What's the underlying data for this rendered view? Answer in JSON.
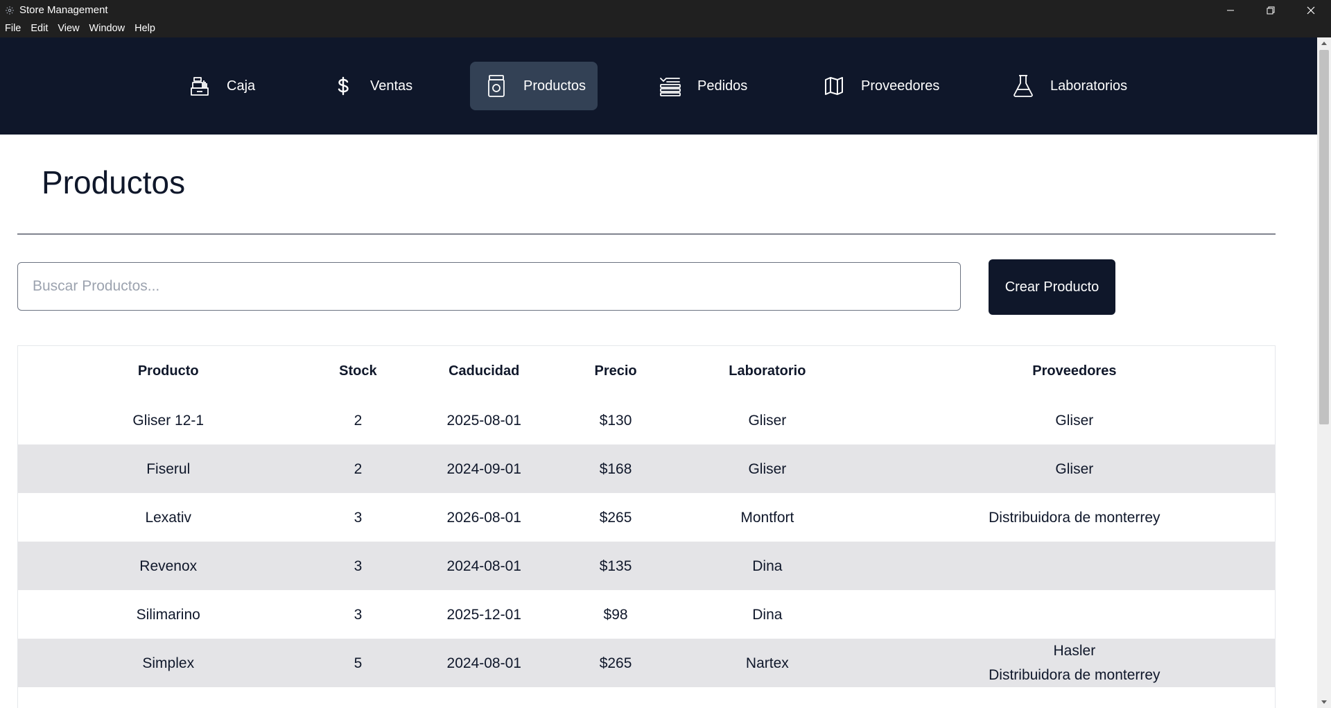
{
  "window": {
    "title": "Store Management"
  },
  "menu": [
    "File",
    "Edit",
    "View",
    "Window",
    "Help"
  ],
  "nav": {
    "items": [
      {
        "label": "Caja",
        "icon": "cash-register-icon"
      },
      {
        "label": "Ventas",
        "icon": "dollar-icon"
      },
      {
        "label": "Productos",
        "icon": "pill-bottle-icon",
        "active": true
      },
      {
        "label": "Pedidos",
        "icon": "stacked-list-icon"
      },
      {
        "label": "Proveedores",
        "icon": "map-icon"
      },
      {
        "label": "Laboratorios",
        "icon": "flask-icon"
      }
    ]
  },
  "page": {
    "title": "Productos"
  },
  "search": {
    "placeholder": "Buscar Productos...",
    "value": ""
  },
  "create_button": {
    "label": "Crear Producto"
  },
  "table": {
    "headers": [
      "Producto",
      "Stock",
      "Caducidad",
      "Precio",
      "Laboratorio",
      "Proveedores"
    ],
    "rows": [
      {
        "producto": "Gliser 12-1",
        "stock": "2",
        "caducidad": "2025-08-01",
        "precio": "$130",
        "laboratorio": "Gliser",
        "proveedores": [
          "Gliser"
        ]
      },
      {
        "producto": "Fiserul",
        "stock": "2",
        "caducidad": "2024-09-01",
        "precio": "$168",
        "laboratorio": "Gliser",
        "proveedores": [
          "Gliser"
        ]
      },
      {
        "producto": "Lexativ",
        "stock": "3",
        "caducidad": "2026-08-01",
        "precio": "$265",
        "laboratorio": "Montfort",
        "proveedores": [
          "Distribuidora de monterrey"
        ]
      },
      {
        "producto": "Revenox",
        "stock": "3",
        "caducidad": "2024-08-01",
        "precio": "$135",
        "laboratorio": "Dina",
        "proveedores": []
      },
      {
        "producto": "Silimarino",
        "stock": "3",
        "caducidad": "2025-12-01",
        "precio": "$98",
        "laboratorio": "Dina",
        "proveedores": []
      },
      {
        "producto": "Simplex",
        "stock": "5",
        "caducidad": "2024-08-01",
        "precio": "$265",
        "laboratorio": "Nartex",
        "proveedores": [
          "Hasler",
          "Distribuidora de monterrey"
        ]
      }
    ]
  },
  "colors": {
    "nav_bg": "#0f172a",
    "nav_active": "#334155",
    "button_bg": "#0f172a",
    "row_alt": "#e4e4e7"
  }
}
